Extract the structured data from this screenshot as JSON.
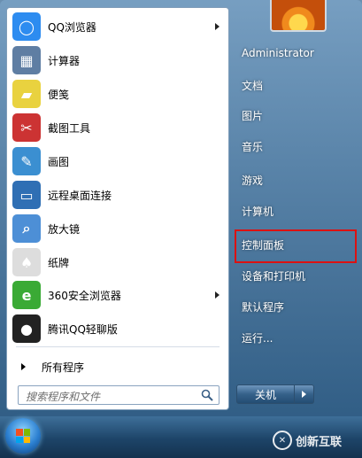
{
  "programs": [
    {
      "label": "QQ浏览器",
      "icon": "qq-browser-icon",
      "has_submenu": true,
      "color": "#2d8cf0",
      "glyph": "◯"
    },
    {
      "label": "计算器",
      "icon": "calculator-icon",
      "has_submenu": false,
      "color": "#5f7ea3",
      "glyph": "▦"
    },
    {
      "label": "便笺",
      "icon": "sticky-notes-icon",
      "has_submenu": false,
      "color": "#e9d23f",
      "glyph": "▰"
    },
    {
      "label": "截图工具",
      "icon": "snipping-tool-icon",
      "has_submenu": false,
      "color": "#c33",
      "glyph": "✂"
    },
    {
      "label": "画图",
      "icon": "paint-icon",
      "has_submenu": false,
      "color": "#3b8fd1",
      "glyph": "✎"
    },
    {
      "label": "远程桌面连接",
      "icon": "remote-desktop-icon",
      "has_submenu": false,
      "color": "#2f6fb4",
      "glyph": "▭"
    },
    {
      "label": "放大镜",
      "icon": "magnifier-icon",
      "has_submenu": false,
      "color": "#4d8fd6",
      "glyph": "⌕"
    },
    {
      "label": "纸牌",
      "icon": "solitaire-icon",
      "has_submenu": false,
      "color": "#ddd",
      "glyph": "♠"
    },
    {
      "label": "360安全浏览器",
      "icon": "360-browser-icon",
      "has_submenu": true,
      "color": "#3aaa35",
      "glyph": "e"
    },
    {
      "label": "腾讯QQ轻聊版",
      "icon": "qq-penguin-icon",
      "has_submenu": false,
      "color": "#222",
      "glyph": "●"
    }
  ],
  "all_programs": "所有程序",
  "search": {
    "placeholder": "搜索程序和文件"
  },
  "right_items": [
    {
      "key": "user",
      "label": "Administrator"
    },
    {
      "key": "documents",
      "label": "文档"
    },
    {
      "key": "pictures",
      "label": "图片"
    },
    {
      "key": "music",
      "label": "音乐"
    },
    {
      "key": "games",
      "label": "游戏"
    },
    {
      "key": "computer",
      "label": "计算机"
    },
    {
      "key": "control-panel",
      "label": "控制面板"
    },
    {
      "key": "devices-printers",
      "label": "设备和打印机"
    },
    {
      "key": "default-programs",
      "label": "默认程序"
    },
    {
      "key": "run",
      "label": "运行..."
    }
  ],
  "shutdown_label": "关机",
  "highlight_color": "#dd1111",
  "watermark": {
    "text": "创新互联"
  }
}
